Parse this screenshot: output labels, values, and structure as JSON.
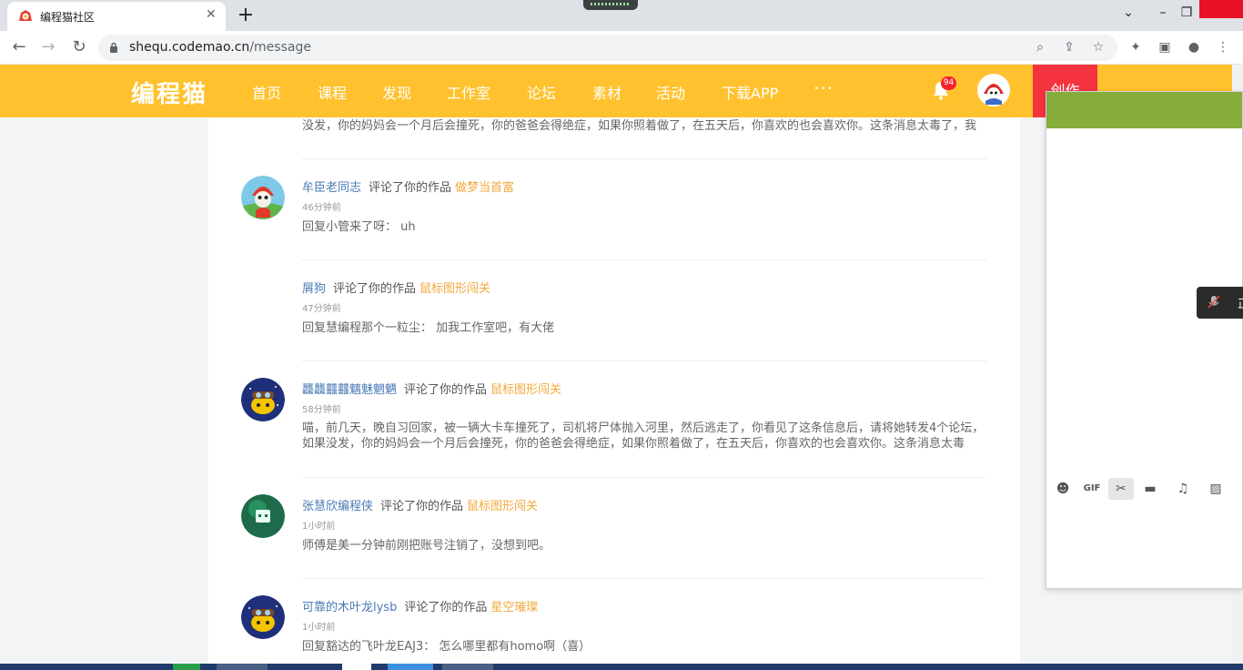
{
  "browser": {
    "tab_title": "编程猫社区",
    "tab_close": "✕",
    "new_tab": "+",
    "url_host": "shequ.codemao.cn",
    "url_path": "/message"
  },
  "header": {
    "logo": "编程猫",
    "nav": [
      "首页",
      "课程",
      "发现",
      "工作室",
      "论坛",
      "素材",
      "活动",
      "下载APP"
    ],
    "more": "···",
    "notification_count": "94",
    "create_label": "创作"
  },
  "messages": [
    {
      "user": "",
      "action": "",
      "work": "",
      "time": "",
      "body": "没发，你的妈妈会一个月后会撞死，你的爸爸会得绝症，如果你照着做了，在五天后，你喜欢的也会喜欢你。这条消息太毒了，我不..."
    },
    {
      "user": "牟臣老同志",
      "action": "评论了你的作品",
      "work": "做梦当首富",
      "time": "46分钟前",
      "body": "回复小管来了呀：  uh"
    },
    {
      "user": "屑狗",
      "action": "评论了你的作品",
      "work": "鼠标图形闯关",
      "time": "47分钟前",
      "body": "回复慧编程那个一粒尘：  加我工作室吧，有大佬"
    },
    {
      "user": "龘龘䨻䨻魑魅魍魉",
      "action": "评论了你的作品",
      "work": "鼠标图形闯关",
      "time": "58分钟前",
      "body": "喵，前几天，晚自习回家，被一辆大卡车撞死了，司机将尸体抛入河里，然后逃走了，你看见了这条信息后，请将她转发4个论坛，如果没发，你的妈妈会一个月后会撞死，你的爸爸会得绝症，如果你照着做了，在五天后，你喜欢的也会喜欢你。这条消息太毒了，我不..."
    },
    {
      "user": "张慧欣编程侠",
      "action": "评论了你的作品",
      "work": "鼠标图形闯关",
      "time": "1小时前",
      "body": "师傅是美一分钟前刚把账号注销了，没想到吧。"
    },
    {
      "user": "可靠的木叶龙lysb",
      "action": "评论了你的作品",
      "work": "星空璀璨",
      "time": "1小时前",
      "body": "回复豁达的飞叶龙EAJ3：  怎么哪里都有homo啊（喜）"
    }
  ],
  "panel": {
    "tools": [
      "emoji-icon",
      "gif-icon",
      "scissors-icon",
      "folder-icon",
      "music-icon",
      "image-icon",
      "video-icon"
    ],
    "gif_label": "GIF",
    "mic_popup_text": "正"
  },
  "colors": {
    "header_bg": "#ffc12d",
    "create_bg": "#f5333f",
    "username": "#4a7bb5",
    "work_link": "#f2a93b",
    "panel_head": "#86ad3b",
    "badge": "#f5222d"
  }
}
